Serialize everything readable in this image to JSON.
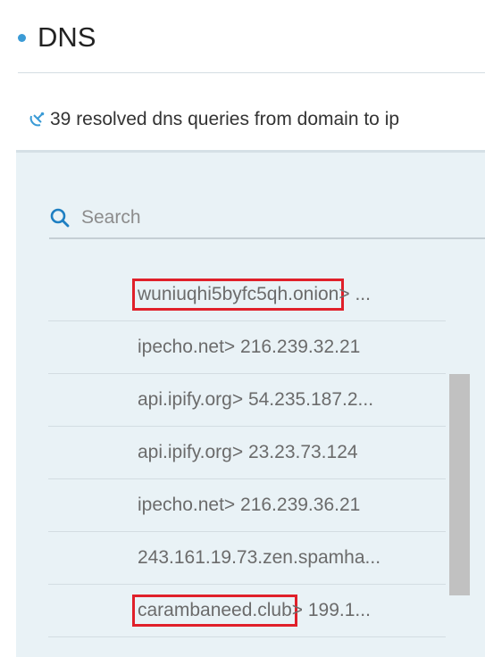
{
  "section": {
    "title": "DNS"
  },
  "summary": {
    "icon": "satellite-dish-icon",
    "text": "39 resolved dns queries from domain to ip"
  },
  "search": {
    "icon": "search-icon",
    "placeholder": "Search",
    "value": ""
  },
  "queries": [
    {
      "domain": "wuniuqhi5byfc5qh.onion",
      "rest": " > ...",
      "highlighted": true
    },
    {
      "domain": "ipecho.net",
      "rest": " > 216.239.32.21",
      "highlighted": false
    },
    {
      "domain": "api.ipify.org",
      "rest": " > 54.235.187.2...",
      "highlighted": false
    },
    {
      "domain": "api.ipify.org",
      "rest": " > 23.23.73.124",
      "highlighted": false
    },
    {
      "domain": "ipecho.net",
      "rest": " > 216.239.36.21",
      "highlighted": false
    },
    {
      "domain": "243.161.19.73.zen.spamha...",
      "rest": "",
      "highlighted": false
    },
    {
      "domain": "carambaneed.club",
      "rest": " > 199.1...",
      "highlighted": true
    }
  ],
  "colors": {
    "accent": "#3b9bd6",
    "highlight": "#e0202a",
    "panel_bg": "#e9f2f6"
  }
}
